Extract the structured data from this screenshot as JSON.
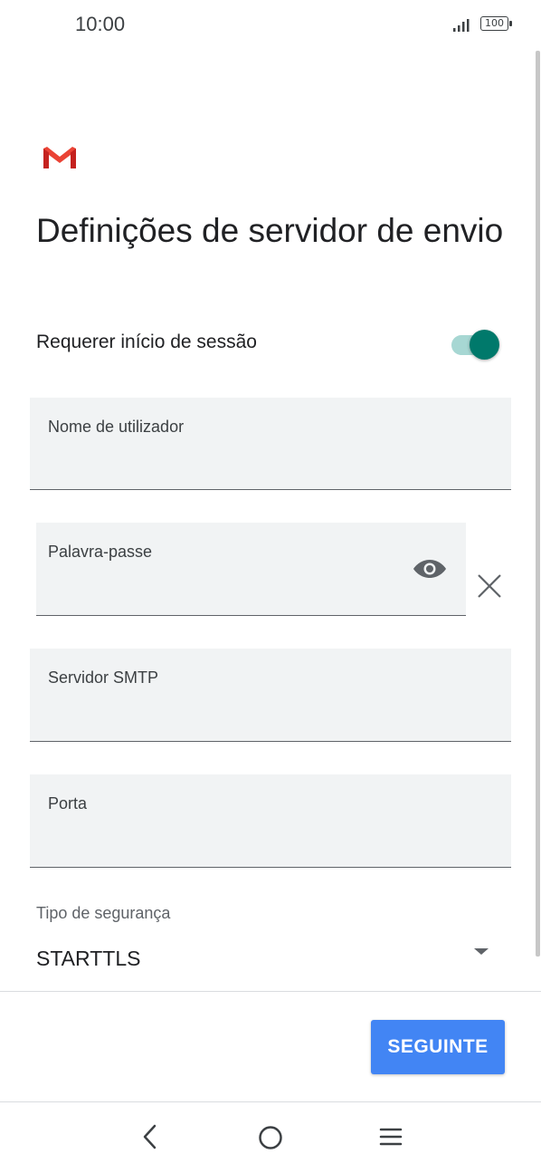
{
  "status_bar": {
    "time": "10:00",
    "battery": "100",
    "icons": [
      "signal-icon",
      "battery-icon"
    ]
  },
  "app": {
    "logo": "gmail-logo"
  },
  "page": {
    "title": "Definições de servidor de envio"
  },
  "require_login": {
    "label": "Requerer início de sessão",
    "enabled": true,
    "accent_color": "#00796b"
  },
  "fields": {
    "username": {
      "label": "Nome de utilizador",
      "value": ""
    },
    "password": {
      "label": "Palavra-passe",
      "value": ""
    },
    "smtp_server": {
      "label": "Servidor SMTP",
      "value": ""
    },
    "port": {
      "label": "Porta",
      "value": ""
    }
  },
  "security": {
    "label": "Tipo de segurança",
    "selected": "STARTTLS"
  },
  "actions": {
    "next_label": "SEGUINTE",
    "next_color": "#4285f4"
  },
  "nav": {
    "icons": [
      "back-icon",
      "home-icon",
      "menu-icon"
    ]
  }
}
